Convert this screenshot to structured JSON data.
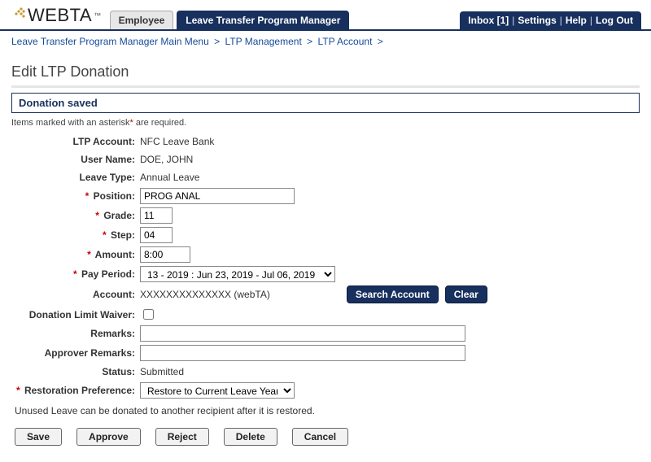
{
  "header": {
    "logo_text": "WEBTA",
    "logo_tm": "™",
    "tabs": {
      "employee": "Employee",
      "ltpm": "Leave Transfer Program Manager"
    },
    "nav": {
      "inbox": "Inbox [1]",
      "settings": "Settings",
      "help": "Help",
      "logout": "Log Out"
    }
  },
  "breadcrumb": {
    "items": [
      "Leave Transfer Program Manager Main Menu",
      "LTP Management",
      "LTP Account"
    ]
  },
  "page": {
    "title": "Edit LTP Donation",
    "alert": "Donation saved",
    "required_note_prefix": "Items marked with an asterisk",
    "required_note_suffix": " are required.",
    "hint": "Unused Leave can be donated to another recipient after it is restored."
  },
  "labels": {
    "ltp_account": "LTP Account:",
    "user_name": "User Name:",
    "leave_type": "Leave Type:",
    "position": "Position:",
    "grade": "Grade:",
    "step": "Step:",
    "amount": "Amount:",
    "pay_period": "Pay Period:",
    "account": "Account:",
    "donation_limit_waiver": "Donation Limit Waiver:",
    "remarks": "Remarks:",
    "approver_remarks": "Approver Remarks:",
    "status": "Status:",
    "restoration_pref": "Restoration Preference:"
  },
  "values": {
    "ltp_account": "NFC Leave Bank",
    "user_name": "DOE, JOHN",
    "leave_type": "Annual Leave",
    "position": "PROG ANAL",
    "grade": "11",
    "step": "04",
    "amount": "8:00",
    "pay_period": "13 - 2019 : Jun 23, 2019 - Jul 06, 2019 *",
    "account": "XXXXXXXXXXXXXX (webTA)",
    "remarks": "",
    "approver_remarks": "",
    "status": "Submitted",
    "restoration_pref": "Restore to Current Leave Year"
  },
  "buttons": {
    "search_account": "Search Account",
    "clear": "Clear",
    "save": "Save",
    "approve": "Approve",
    "reject": "Reject",
    "delete": "Delete",
    "cancel": "Cancel"
  }
}
